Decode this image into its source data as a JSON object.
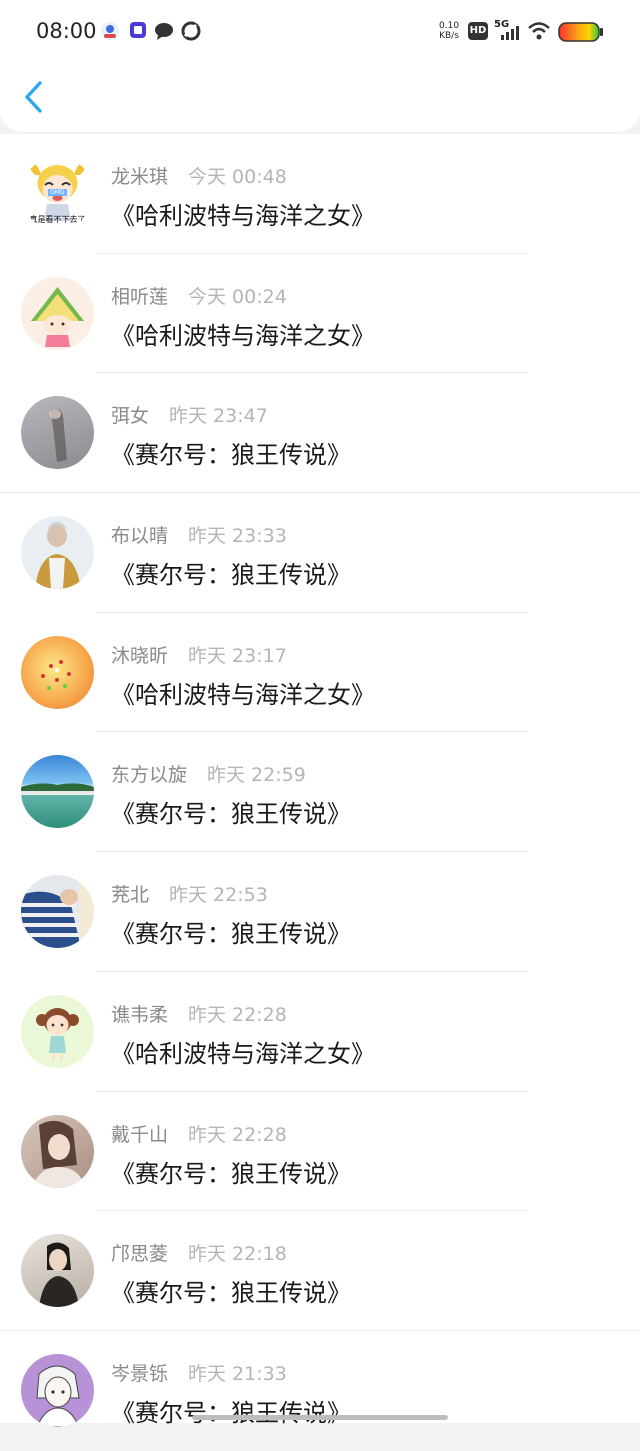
{
  "status": {
    "time": "08:00",
    "net_speed": "0.10",
    "net_unit": "KB/s",
    "hd": "HD",
    "signal": "5G"
  },
  "colors": {
    "accent": "#2aa8f2"
  },
  "rows": [
    {
      "user": "龙米琪",
      "time": "今天 00:48",
      "book": "《哈利波特与海洋之女》",
      "avatar_caption": "真是看不下去了",
      "avatar_badge": "OMG"
    },
    {
      "user": "相听莲",
      "time": "今天 00:24",
      "book": "《哈利波特与海洋之女》",
      "avatar_caption": "",
      "avatar_badge": ""
    },
    {
      "user": "弭女",
      "time": "昨天 23:47",
      "book": "《赛尔号：狼王传说》",
      "avatar_caption": "",
      "avatar_badge": ""
    },
    {
      "user": "布以晴",
      "time": "昨天 23:33",
      "book": "《赛尔号：狼王传说》",
      "avatar_caption": "",
      "avatar_badge": ""
    },
    {
      "user": "沐晓昕",
      "time": "昨天 23:17",
      "book": "《哈利波特与海洋之女》",
      "avatar_caption": "",
      "avatar_badge": ""
    },
    {
      "user": "东方以旋",
      "time": "昨天 22:59",
      "book": "《赛尔号：狼王传说》",
      "avatar_caption": "",
      "avatar_badge": ""
    },
    {
      "user": "茺北",
      "time": "昨天 22:53",
      "book": "《赛尔号：狼王传说》",
      "avatar_caption": "",
      "avatar_badge": ""
    },
    {
      "user": "谯韦柔",
      "time": "昨天 22:28",
      "book": "《哈利波特与海洋之女》",
      "avatar_caption": "",
      "avatar_badge": ""
    },
    {
      "user": "戴千山",
      "time": "昨天 22:28",
      "book": "《赛尔号：狼王传说》",
      "avatar_caption": "",
      "avatar_badge": ""
    },
    {
      "user": "邝思菱",
      "time": "昨天 22:18",
      "book": "《赛尔号：狼王传说》",
      "avatar_caption": "",
      "avatar_badge": ""
    },
    {
      "user": "岑景铄",
      "time": "昨天 21:33",
      "book": "《赛尔号：狼王传说》",
      "avatar_caption": "",
      "avatar_badge": ""
    }
  ]
}
